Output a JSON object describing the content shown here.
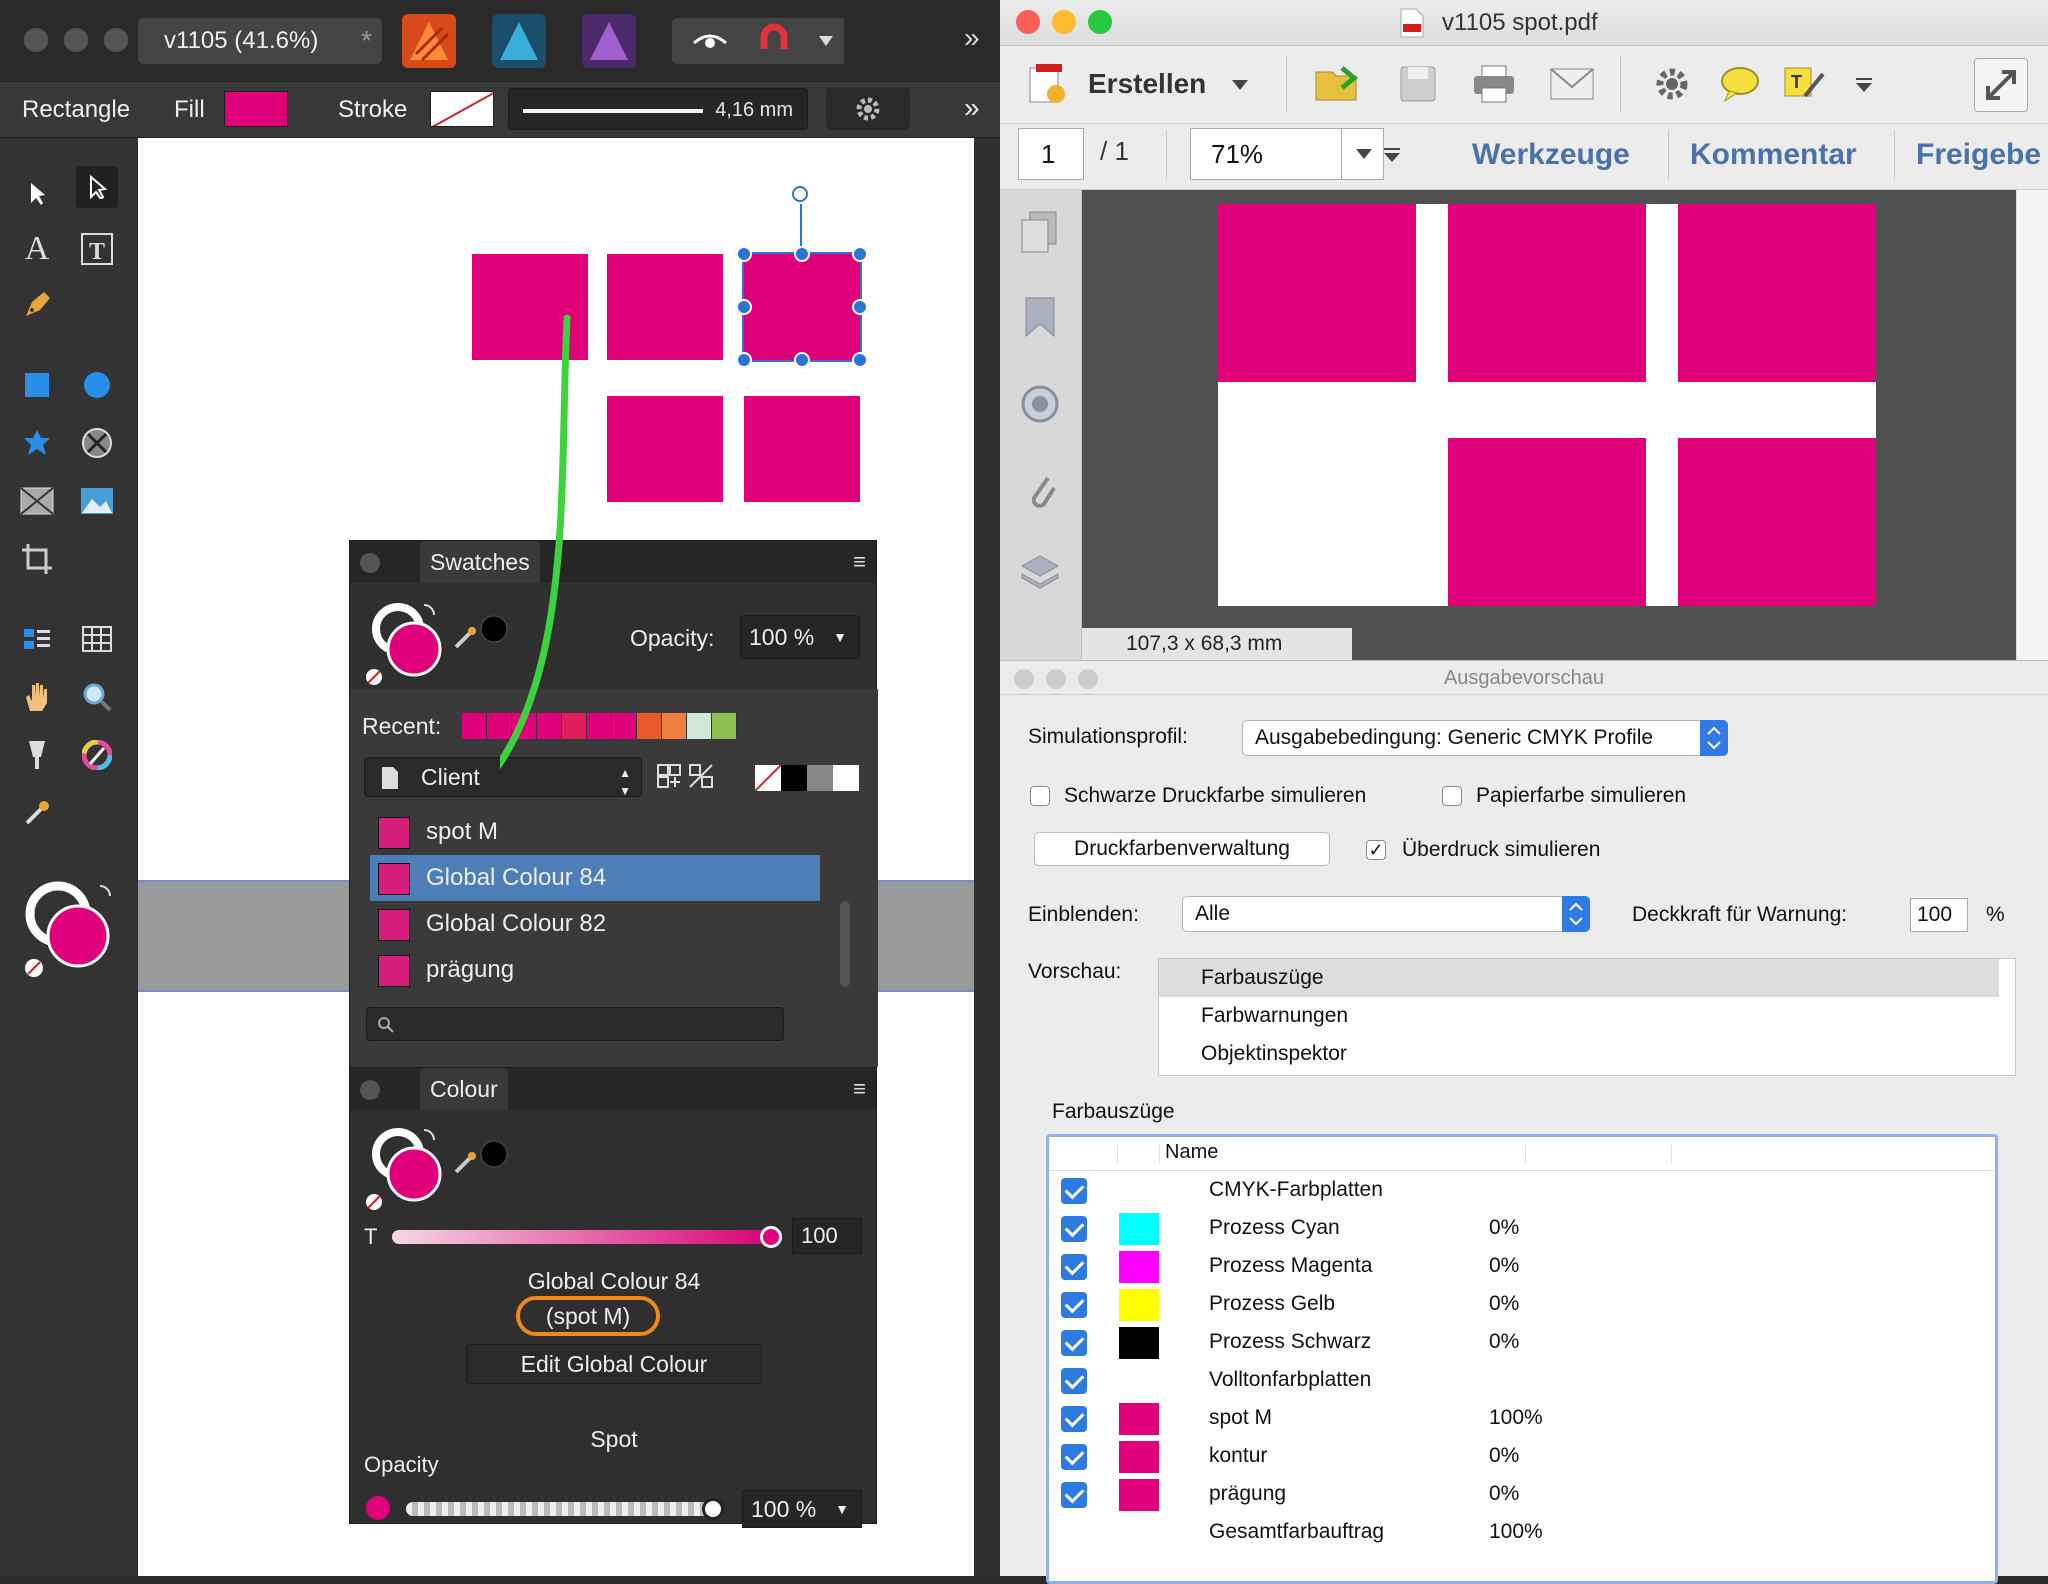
{
  "left_app": {
    "doc_tab": "v1105 (41.6%)",
    "modified_marker": "*",
    "overflow": "»",
    "context": {
      "tool": "Rectangle",
      "fill_label": "Fill",
      "stroke_label": "Stroke",
      "stroke_width": "4,16 mm"
    },
    "swatches": {
      "title": "Swatches",
      "opacity_label": "Opacity:",
      "opacity_value": "100 %",
      "recent_label": "Recent:",
      "recent_colors": [
        "#e0007a",
        "#e0007a",
        "#e0007a",
        "#e0007a",
        "#e01e5a",
        "#e0007a",
        "#e0007a",
        "#e85a2a",
        "#f08040",
        "#cfe8d8",
        "#8cc050"
      ],
      "palette": "Client",
      "items": [
        {
          "label": "spot M"
        },
        {
          "label": "Global Colour 84"
        },
        {
          "label": "Global Colour 82"
        },
        {
          "label": "prägung"
        }
      ]
    },
    "colour": {
      "title": "Colour",
      "tint_label": "T",
      "tint_value": "100",
      "name": "Global Colour 84",
      "spot_ref": "(spot M)",
      "edit_button": "Edit Global Colour",
      "mode": "Spot",
      "opacity_label": "Opacity",
      "opacity_value": "100 %"
    },
    "accent": "#e0007a"
  },
  "right_app": {
    "title": "v1105 spot.pdf",
    "create_button": "Erstellen",
    "page_current": "1",
    "page_total": "/ 1",
    "zoom": "71%",
    "tabs": {
      "tools": "Werkzeuge",
      "comment": "Kommentar",
      "share": "Freigebe"
    },
    "page_size": "107,3 x 68,3 mm",
    "dialog": {
      "title": "Ausgabevorschau",
      "sim_profile_label": "Simulationsprofil:",
      "sim_profile_value": "Ausgabebedingung: Generic CMYK Profile",
      "black_ink": "Schwarze Druckfarbe simulieren",
      "paper_color": "Papierfarbe simulieren",
      "ink_manager": "Druckfarbenverwaltung",
      "overprint": "Überdruck simulieren",
      "show_label": "Einblenden:",
      "show_value": "Alle",
      "warn_opacity_label": "Deckkraft für Warnung:",
      "warn_opacity_value": "100",
      "percent": "%",
      "preview_label": "Vorschau:",
      "preview_items": [
        "Farbauszüge",
        "Farbwarnungen",
        "Objektinspektor"
      ],
      "separations_label": "Farbauszüge",
      "col_name": "Name",
      "rows": [
        {
          "name": "CMYK-Farbplatten",
          "value": "",
          "color": ""
        },
        {
          "name": "Prozess Cyan",
          "value": "0%",
          "color": "#00ffff"
        },
        {
          "name": "Prozess Magenta",
          "value": "0%",
          "color": "#ff00ff"
        },
        {
          "name": "Prozess Gelb",
          "value": "0%",
          "color": "#ffff00"
        },
        {
          "name": "Prozess Schwarz",
          "value": "0%",
          "color": "#000000"
        },
        {
          "name": "Volltonfarbplatten",
          "value": "",
          "color": ""
        },
        {
          "name": "spot M",
          "value": "100%",
          "color": "#e0007a"
        },
        {
          "name": "kontur",
          "value": "0%",
          "color": "#e0007a"
        },
        {
          "name": "prägung",
          "value": "0%",
          "color": "#e0007a"
        },
        {
          "name": "Gesamtfarbauftrag",
          "value": "100%",
          "color": ""
        }
      ]
    }
  }
}
